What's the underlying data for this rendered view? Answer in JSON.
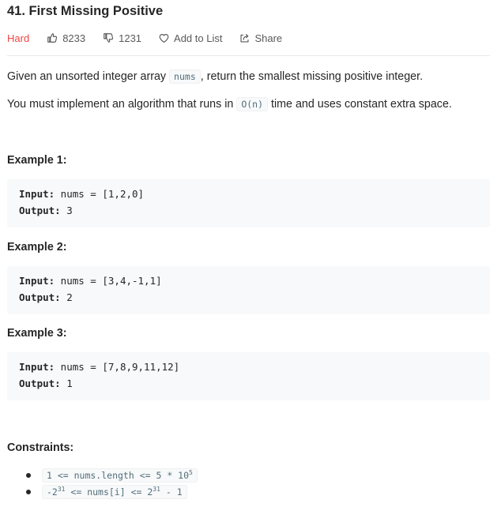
{
  "problem": {
    "title": "41. First Missing Positive",
    "difficulty": "Hard",
    "likes": "8233",
    "dislikes": "1231",
    "add_to_list": "Add to List",
    "share": "Share"
  },
  "description": {
    "p1_before": "Given an unsorted integer array ",
    "p1_code": "nums",
    "p1_after": ", return the smallest missing positive integer.",
    "p2_before": "You must implement an algorithm that runs in ",
    "p2_code": "O(n)",
    "p2_after": " time and uses constant extra space."
  },
  "examples": [
    {
      "heading": "Example 1:",
      "input_label": "Input:",
      "input_value": " nums = [1,2,0]",
      "output_label": "Output:",
      "output_value": " 3"
    },
    {
      "heading": "Example 2:",
      "input_label": "Input:",
      "input_value": " nums = [3,4,-1,1]",
      "output_label": "Output:",
      "output_value": " 2"
    },
    {
      "heading": "Example 3:",
      "input_label": "Input:",
      "input_value": " nums = [7,8,9,11,12]",
      "output_label": "Output:",
      "output_value": " 1"
    }
  ],
  "constraints": {
    "heading": "Constraints:",
    "c1_main": "1 <= nums.length <= 5 * 10",
    "c1_sup": "5",
    "c2_a": "-2",
    "c2_sup1": "31",
    "c2_b": " <= nums[i] <= 2",
    "c2_sup2": "31",
    "c2_c": " - 1"
  },
  "icons": {
    "like": "thumbs-up-icon",
    "dislike": "thumbs-down-icon",
    "add": "heart-icon",
    "share": "share-icon"
  },
  "colors": {
    "hard": "#ef4743",
    "text": "#262626",
    "code_bg": "#f7f9fa"
  }
}
